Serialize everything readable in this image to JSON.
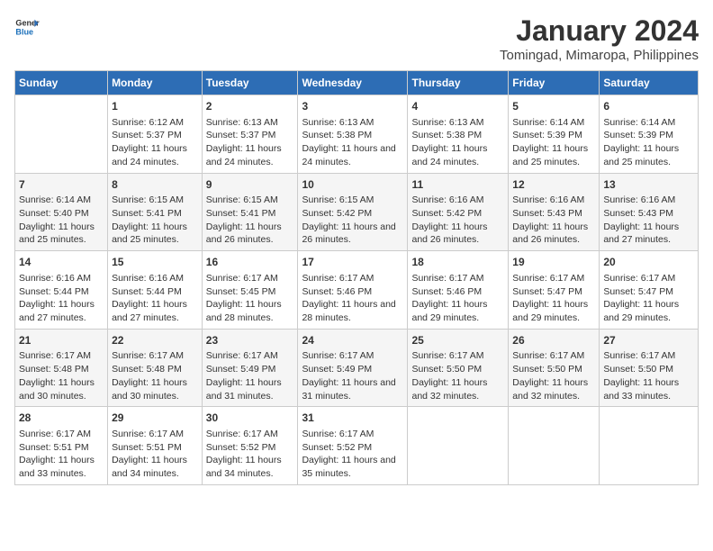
{
  "logo": {
    "general": "General",
    "blue": "Blue"
  },
  "title": "January 2024",
  "subtitle": "Tomingad, Mimaropa, Philippines",
  "calendar": {
    "headers": [
      "Sunday",
      "Monday",
      "Tuesday",
      "Wednesday",
      "Thursday",
      "Friday",
      "Saturday"
    ],
    "rows": [
      [
        {
          "day": "",
          "content": ""
        },
        {
          "day": "1",
          "content": "Sunrise: 6:12 AM\nSunset: 5:37 PM\nDaylight: 11 hours and 24 minutes."
        },
        {
          "day": "2",
          "content": "Sunrise: 6:13 AM\nSunset: 5:37 PM\nDaylight: 11 hours and 24 minutes."
        },
        {
          "day": "3",
          "content": "Sunrise: 6:13 AM\nSunset: 5:38 PM\nDaylight: 11 hours and 24 minutes."
        },
        {
          "day": "4",
          "content": "Sunrise: 6:13 AM\nSunset: 5:38 PM\nDaylight: 11 hours and 24 minutes."
        },
        {
          "day": "5",
          "content": "Sunrise: 6:14 AM\nSunset: 5:39 PM\nDaylight: 11 hours and 25 minutes."
        },
        {
          "day": "6",
          "content": "Sunrise: 6:14 AM\nSunset: 5:39 PM\nDaylight: 11 hours and 25 minutes."
        }
      ],
      [
        {
          "day": "7",
          "content": "Sunrise: 6:14 AM\nSunset: 5:40 PM\nDaylight: 11 hours and 25 minutes."
        },
        {
          "day": "8",
          "content": "Sunrise: 6:15 AM\nSunset: 5:41 PM\nDaylight: 11 hours and 25 minutes."
        },
        {
          "day": "9",
          "content": "Sunrise: 6:15 AM\nSunset: 5:41 PM\nDaylight: 11 hours and 26 minutes."
        },
        {
          "day": "10",
          "content": "Sunrise: 6:15 AM\nSunset: 5:42 PM\nDaylight: 11 hours and 26 minutes."
        },
        {
          "day": "11",
          "content": "Sunrise: 6:16 AM\nSunset: 5:42 PM\nDaylight: 11 hours and 26 minutes."
        },
        {
          "day": "12",
          "content": "Sunrise: 6:16 AM\nSunset: 5:43 PM\nDaylight: 11 hours and 26 minutes."
        },
        {
          "day": "13",
          "content": "Sunrise: 6:16 AM\nSunset: 5:43 PM\nDaylight: 11 hours and 27 minutes."
        }
      ],
      [
        {
          "day": "14",
          "content": "Sunrise: 6:16 AM\nSunset: 5:44 PM\nDaylight: 11 hours and 27 minutes."
        },
        {
          "day": "15",
          "content": "Sunrise: 6:16 AM\nSunset: 5:44 PM\nDaylight: 11 hours and 27 minutes."
        },
        {
          "day": "16",
          "content": "Sunrise: 6:17 AM\nSunset: 5:45 PM\nDaylight: 11 hours and 28 minutes."
        },
        {
          "day": "17",
          "content": "Sunrise: 6:17 AM\nSunset: 5:46 PM\nDaylight: 11 hours and 28 minutes."
        },
        {
          "day": "18",
          "content": "Sunrise: 6:17 AM\nSunset: 5:46 PM\nDaylight: 11 hours and 29 minutes."
        },
        {
          "day": "19",
          "content": "Sunrise: 6:17 AM\nSunset: 5:47 PM\nDaylight: 11 hours and 29 minutes."
        },
        {
          "day": "20",
          "content": "Sunrise: 6:17 AM\nSunset: 5:47 PM\nDaylight: 11 hours and 29 minutes."
        }
      ],
      [
        {
          "day": "21",
          "content": "Sunrise: 6:17 AM\nSunset: 5:48 PM\nDaylight: 11 hours and 30 minutes."
        },
        {
          "day": "22",
          "content": "Sunrise: 6:17 AM\nSunset: 5:48 PM\nDaylight: 11 hours and 30 minutes."
        },
        {
          "day": "23",
          "content": "Sunrise: 6:17 AM\nSunset: 5:49 PM\nDaylight: 11 hours and 31 minutes."
        },
        {
          "day": "24",
          "content": "Sunrise: 6:17 AM\nSunset: 5:49 PM\nDaylight: 11 hours and 31 minutes."
        },
        {
          "day": "25",
          "content": "Sunrise: 6:17 AM\nSunset: 5:50 PM\nDaylight: 11 hours and 32 minutes."
        },
        {
          "day": "26",
          "content": "Sunrise: 6:17 AM\nSunset: 5:50 PM\nDaylight: 11 hours and 32 minutes."
        },
        {
          "day": "27",
          "content": "Sunrise: 6:17 AM\nSunset: 5:50 PM\nDaylight: 11 hours and 33 minutes."
        }
      ],
      [
        {
          "day": "28",
          "content": "Sunrise: 6:17 AM\nSunset: 5:51 PM\nDaylight: 11 hours and 33 minutes."
        },
        {
          "day": "29",
          "content": "Sunrise: 6:17 AM\nSunset: 5:51 PM\nDaylight: 11 hours and 34 minutes."
        },
        {
          "day": "30",
          "content": "Sunrise: 6:17 AM\nSunset: 5:52 PM\nDaylight: 11 hours and 34 minutes."
        },
        {
          "day": "31",
          "content": "Sunrise: 6:17 AM\nSunset: 5:52 PM\nDaylight: 11 hours and 35 minutes."
        },
        {
          "day": "",
          "content": ""
        },
        {
          "day": "",
          "content": ""
        },
        {
          "day": "",
          "content": ""
        }
      ]
    ]
  }
}
